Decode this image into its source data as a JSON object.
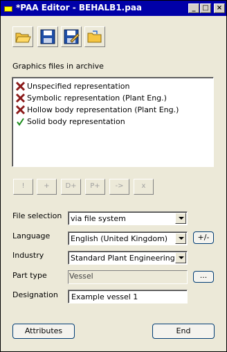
{
  "window": {
    "title": "*PAA Editor - BEHALB1.paa",
    "minimize_glyph": "_",
    "maximize_glyph": "□",
    "close_glyph": "×"
  },
  "toolbar": {
    "buttons": [
      {
        "name": "open-folder-icon"
      },
      {
        "name": "save-icon"
      },
      {
        "name": "save-as-icon"
      },
      {
        "name": "folder-icon"
      }
    ]
  },
  "graphics": {
    "label": "Graphics files in archive",
    "items": [
      {
        "text": "Unspecified representation",
        "status": "missing"
      },
      {
        "text": "Symbolic representation (Plant Eng.)",
        "status": "missing"
      },
      {
        "text": "Hollow body representation (Plant Eng.)",
        "status": "missing"
      },
      {
        "text": "Solid body representation",
        "status": "present"
      }
    ],
    "actions": [
      "!",
      "+",
      "D+",
      "P+",
      "->",
      "x"
    ]
  },
  "form": {
    "file_selection": {
      "label": "File selection",
      "value": "via file system"
    },
    "language": {
      "label": "Language",
      "value": "English (United Kingdom)",
      "extra_button": "+/-"
    },
    "industry": {
      "label": "Industry",
      "value": "Standard Plant Engineering"
    },
    "part_type": {
      "label": "Part type",
      "value": "Vessel",
      "browse_button": "..."
    },
    "designation": {
      "label": "Designation",
      "value": "Example vessel 1"
    }
  },
  "footer": {
    "attributes_label": "Attributes",
    "end_label": "End"
  },
  "colors": {
    "titlebar": "#0000a8",
    "dialog_bg": "#ece9d8",
    "missing_x": "#8b1a1a",
    "present_check": "#1a8a1a"
  }
}
